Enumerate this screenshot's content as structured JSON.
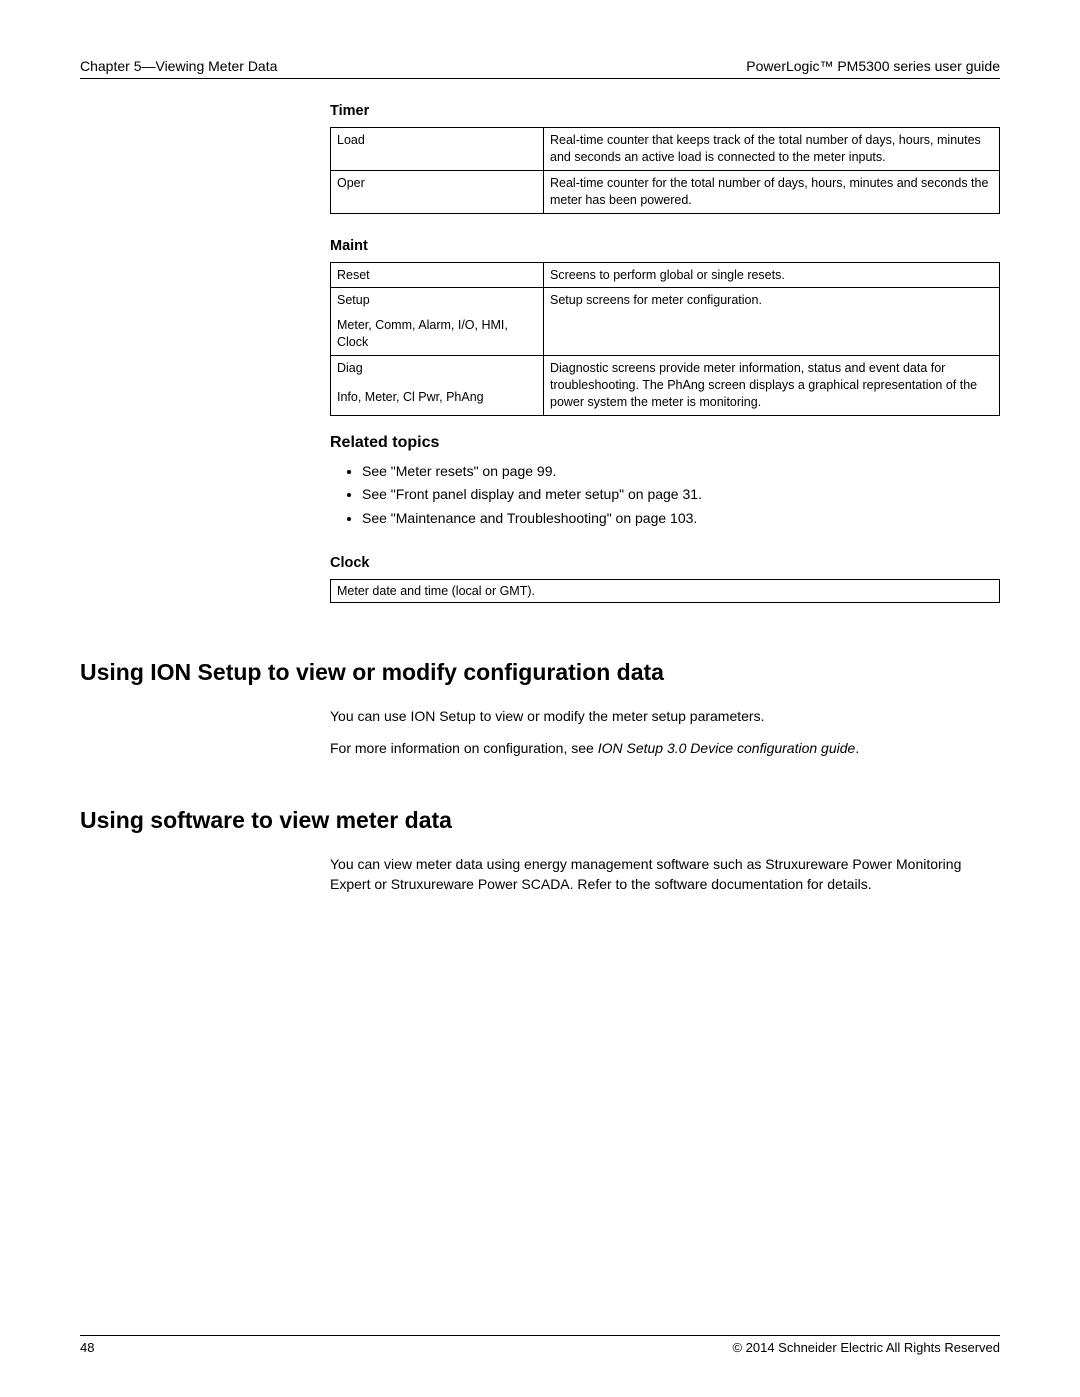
{
  "header": {
    "left": "Chapter 5—Viewing Meter Data",
    "right": "PowerLogic™  PM5300 series user guide"
  },
  "timer": {
    "title": "Timer",
    "rows": [
      {
        "label": "Load",
        "desc": "Real-time counter that keeps track of the total number of days, hours, minutes and seconds an active load is connected to the meter inputs."
      },
      {
        "label": "Oper",
        "desc": "Real-time counter for the total number of days, hours, minutes and seconds the meter has been powered."
      }
    ]
  },
  "maint": {
    "title": "Maint",
    "reset": {
      "label": "Reset",
      "desc": "Screens to perform global or single resets."
    },
    "setup": {
      "label": "Setup",
      "sub": "Meter, Comm, Alarm, I/O, HMI, Clock",
      "desc": "Setup screens for meter configuration."
    },
    "diag": {
      "label": "Diag",
      "sub": "Info, Meter, Cl Pwr, PhAng",
      "desc": "Diagnostic screens provide meter information, status and event data for troubleshooting. The PhAng screen displays a graphical representation of the power system the meter is monitoring."
    }
  },
  "related": {
    "title": "Related topics",
    "items": [
      "See \"Meter resets\" on page 99.",
      "See \"Front panel display and meter setup\" on page 31.",
      "See \"Maintenance and Troubleshooting\" on page 103."
    ]
  },
  "clock": {
    "title": "Clock",
    "text": "Meter date and time (local or GMT)."
  },
  "ion": {
    "heading": "Using ION Setup to view or modify configuration data",
    "p1": "You can use ION Setup to view or modify the meter setup parameters.",
    "p2_pre": "For more information on configuration, see ",
    "p2_italic": "ION Setup 3.0 Device configuration guide",
    "p2_post": "."
  },
  "software": {
    "heading": "Using software to view meter data",
    "p1": "You can view meter data using energy management software such as Struxureware Power Monitoring Expert or Struxureware Power SCADA. Refer to the software documentation for details."
  },
  "footer": {
    "page": "48",
    "copyright": "© 2014 Schneider Electric All Rights Reserved"
  }
}
